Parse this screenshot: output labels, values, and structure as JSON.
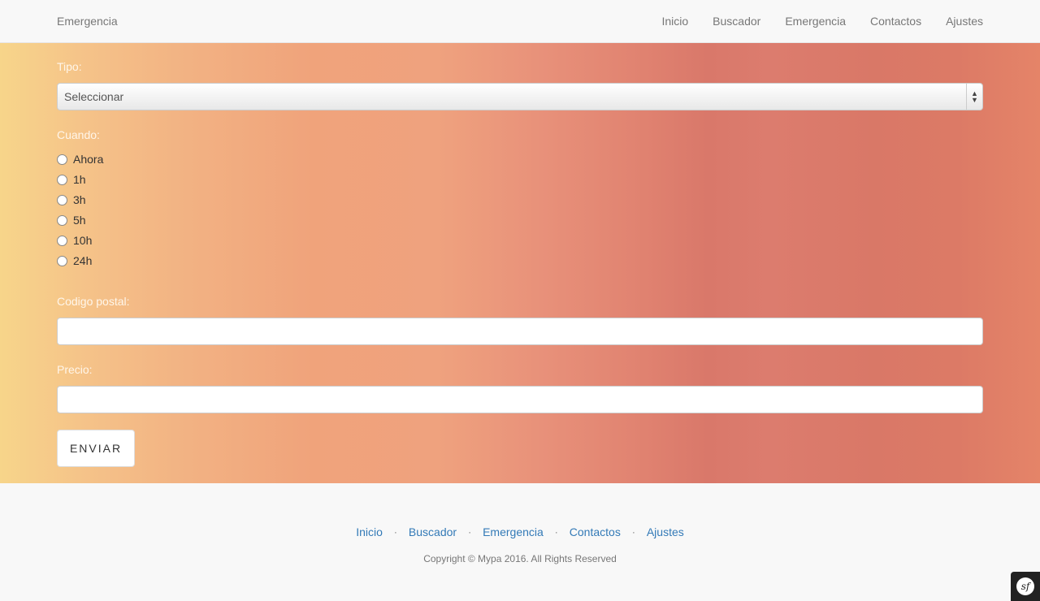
{
  "navbar": {
    "brand": "Emergencia",
    "links": [
      "Inicio",
      "Buscador",
      "Emergencia",
      "Contactos",
      "Ajustes"
    ]
  },
  "form": {
    "tipo_label": "Tipo:",
    "tipo_selected": "Seleccionar",
    "cuando_label": "Cuando:",
    "cuando_options": [
      "Ahora",
      "1h",
      "3h",
      "5h",
      "10h",
      "24h"
    ],
    "codigo_postal_label": "Codigo postal:",
    "codigo_postal_value": "",
    "precio_label": "Precio:",
    "precio_value": "",
    "submit_label": "ENVIAR"
  },
  "footer": {
    "links": [
      "Inicio",
      "Buscador",
      "Emergencia",
      "Contactos",
      "Ajustes"
    ],
    "separator": "·",
    "copyright": "Copyright © Mypa 2016. All Rights Reserved"
  },
  "debug_toolbar": {
    "icon": "symfony-icon",
    "glyph": "sf"
  },
  "colors": {
    "gradient_start": "#f7d58a",
    "gradient_mid": "#efa27e",
    "gradient_end": "#d9786a",
    "footer_link": "#337ab7",
    "navbar_bg": "#f8f8f8"
  }
}
